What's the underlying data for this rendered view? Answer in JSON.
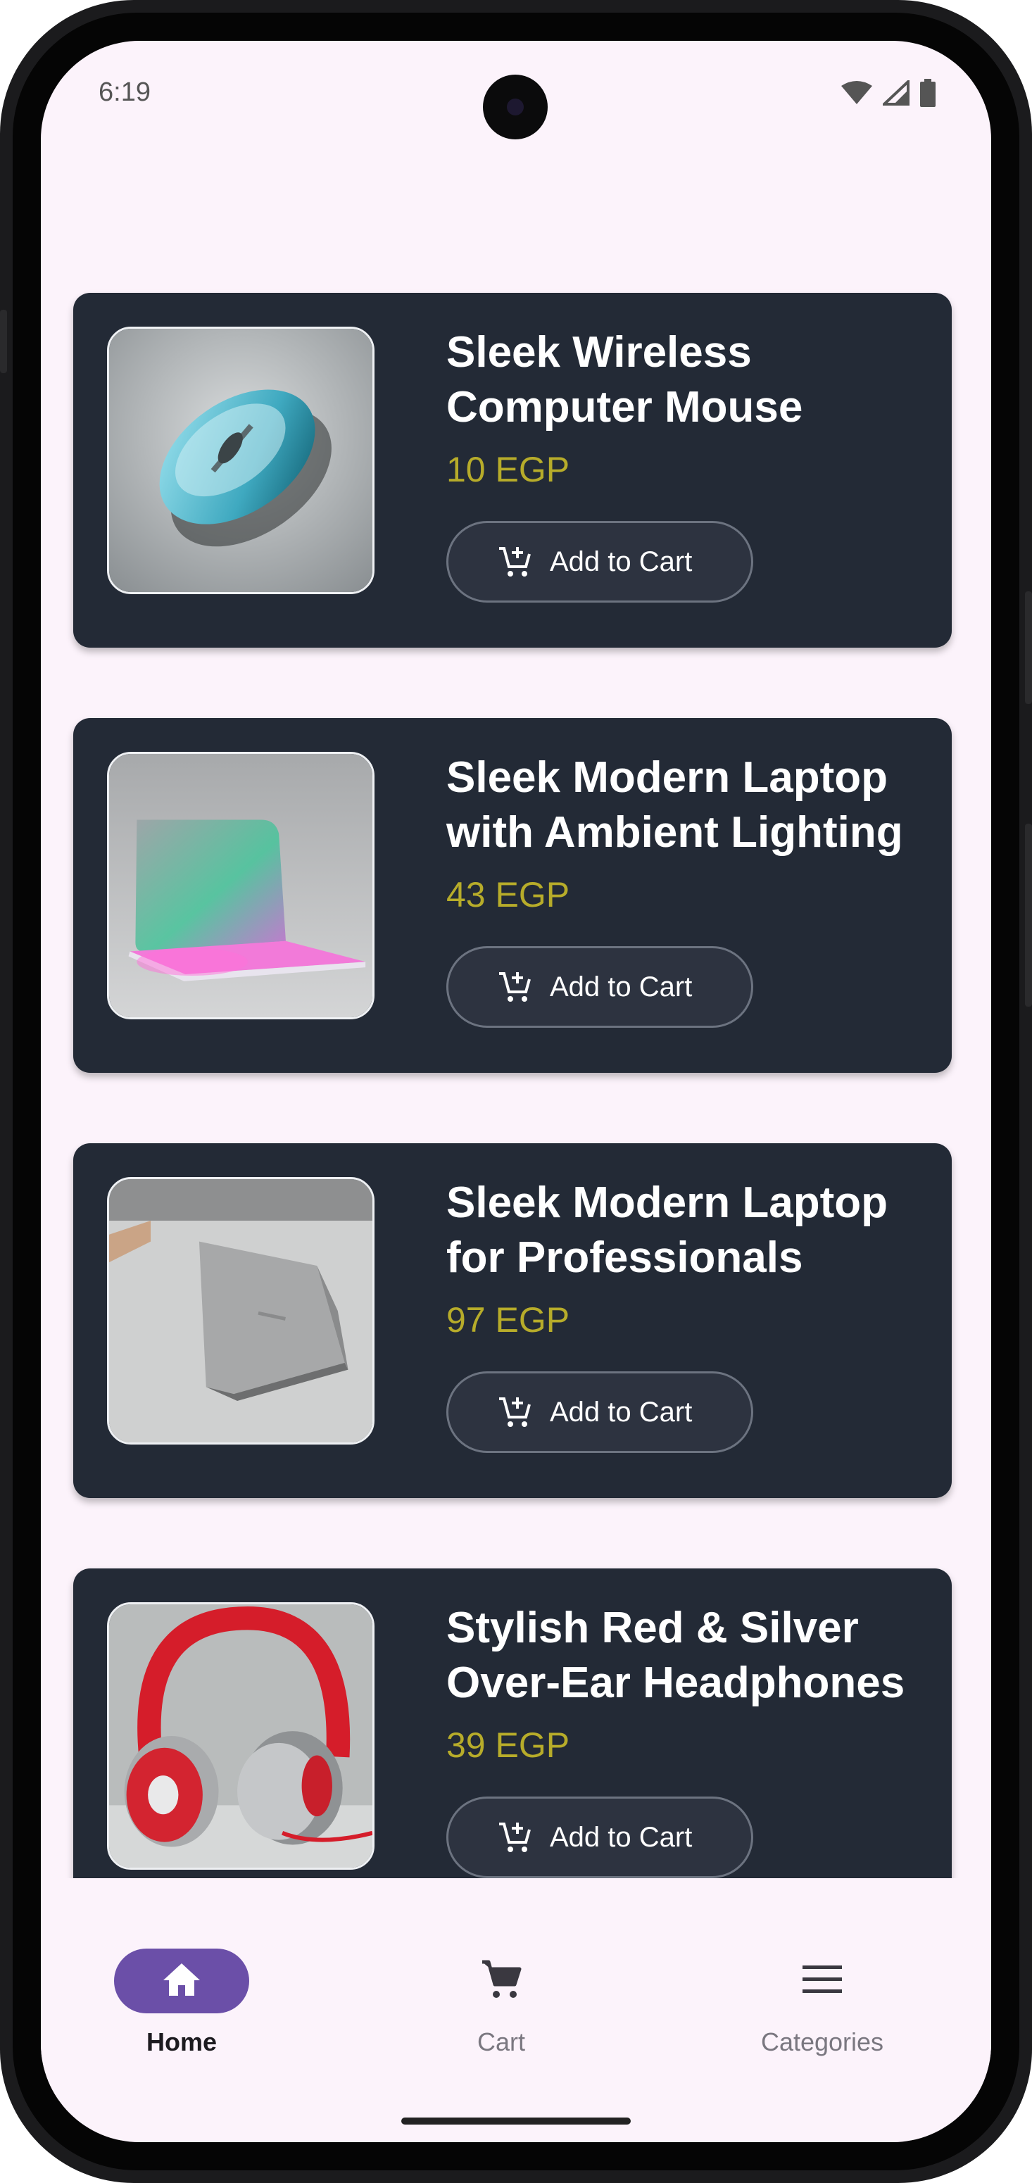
{
  "status_bar": {
    "time": "6:19",
    "icons": [
      "wifi-icon",
      "signal-icon",
      "battery-icon"
    ]
  },
  "products": [
    {
      "title": "Sleek Wireless Computer Mouse",
      "price": "10 EGP",
      "button_label": "Add to Cart",
      "image": "mouse"
    },
    {
      "title": "Sleek Modern Laptop with Ambient Lighting",
      "price": "43 EGP",
      "button_label": "Add to Cart",
      "image": "laptop-rgb"
    },
    {
      "title": "Sleek Modern Laptop for Professionals",
      "price": "97 EGP",
      "button_label": "Add to Cart",
      "image": "laptop-silver"
    },
    {
      "title": "Stylish Red & Silver Over-Ear Headphones",
      "price": "39 EGP",
      "button_label": "Add to Cart",
      "image": "headphones"
    }
  ],
  "bottom_nav": {
    "items": [
      {
        "label": "Home",
        "icon": "home-icon",
        "selected": true
      },
      {
        "label": "Cart",
        "icon": "cart-icon",
        "selected": false
      },
      {
        "label": "Categories",
        "icon": "menu-icon",
        "selected": false
      }
    ]
  },
  "colors": {
    "screen_background": "#fcf3fb",
    "card_background": "#232a36",
    "price_text": "#b7ac2a",
    "nav_selected_pill": "#6b4fa8",
    "nav_unselected": "#7a7780"
  }
}
